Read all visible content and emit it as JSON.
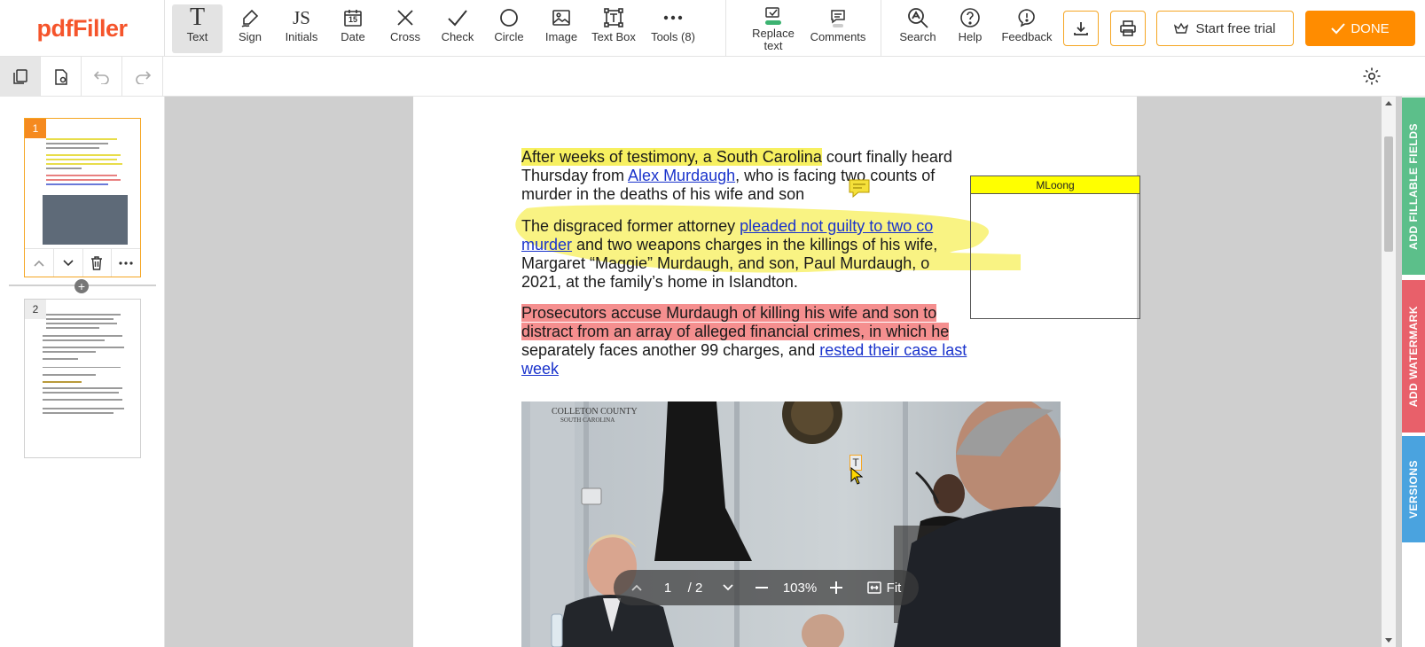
{
  "app": {
    "logo": "pdfFiller"
  },
  "toolbar": {
    "tools": [
      {
        "id": "text",
        "label": "Text"
      },
      {
        "id": "sign",
        "label": "Sign"
      },
      {
        "id": "initials",
        "label": "Initials"
      },
      {
        "id": "date",
        "label": "Date"
      },
      {
        "id": "cross",
        "label": "Cross"
      },
      {
        "id": "check",
        "label": "Check"
      },
      {
        "id": "circle",
        "label": "Circle"
      },
      {
        "id": "image",
        "label": "Image"
      },
      {
        "id": "textbox",
        "label": "Text Box"
      },
      {
        "id": "tools",
        "label": "Tools (8)"
      }
    ],
    "replace_text_line1": "Replace",
    "replace_text_line2": "text",
    "comments": "Comments",
    "search": "Search",
    "help": "Help",
    "feedback": "Feedback",
    "start_trial": "Start free trial",
    "done": "DONE",
    "initials_glyph": "JS",
    "date_glyph": "15",
    "text_glyph": "T"
  },
  "thumbnails": {
    "pages": [
      {
        "number": "1"
      },
      {
        "number": "2"
      }
    ]
  },
  "document": {
    "p1_hl": "After weeks of testimony, a South Carolina",
    "p1_a": " court finally heard",
    "p1_b": "Thursday from ",
    "p1_link": "Alex Murdaugh",
    "p1_c": ", who is facing two counts of",
    "p1_d": "murder in the deaths of his wife and son",
    "p2_a": "The disgraced former attorney ",
    "p2_link1": "pleaded not guilty to two co",
    "p2_link2": "murder",
    "p2_b": " and two weapons charges in the killings of his wife,",
    "p2_c": "Margaret “Maggie” Murdaugh, and son, Paul Murdaugh, o",
    "p2_d": "2021, at the family’s home in Islandton.",
    "p3_hl1": "Prosecutors accuse Murdaugh of killing his wife and son to",
    "p3_hl2": "distract from an array of alleged financial crimes, in which he",
    "p3_a": "separately faces another 99 charges, and ",
    "p3_link1": "rested their case last",
    "p3_link2": "week",
    "annotation_author": "MLoong",
    "photo_caption_1": "COLLETON COUNTY",
    "photo_caption_2": "SOUTH CAROLINA",
    "text_cursor": "T"
  },
  "pagenav": {
    "current_page": "1",
    "total": "/ 2",
    "zoom": "103%",
    "fit": "Fit"
  },
  "sidetabs": {
    "fillable": "ADD FILLABLE FIELDS",
    "watermark": "ADD WATERMARK",
    "versions": "VERSIONS"
  },
  "colors": {
    "brand": "#f5542b",
    "accent": "#ff8c00",
    "highlight_yellow": "#f7f060",
    "highlight_red": "#f58f8f",
    "tab_green": "#5cbf8a",
    "tab_red": "#e8606a",
    "tab_blue": "#4aa3df"
  }
}
